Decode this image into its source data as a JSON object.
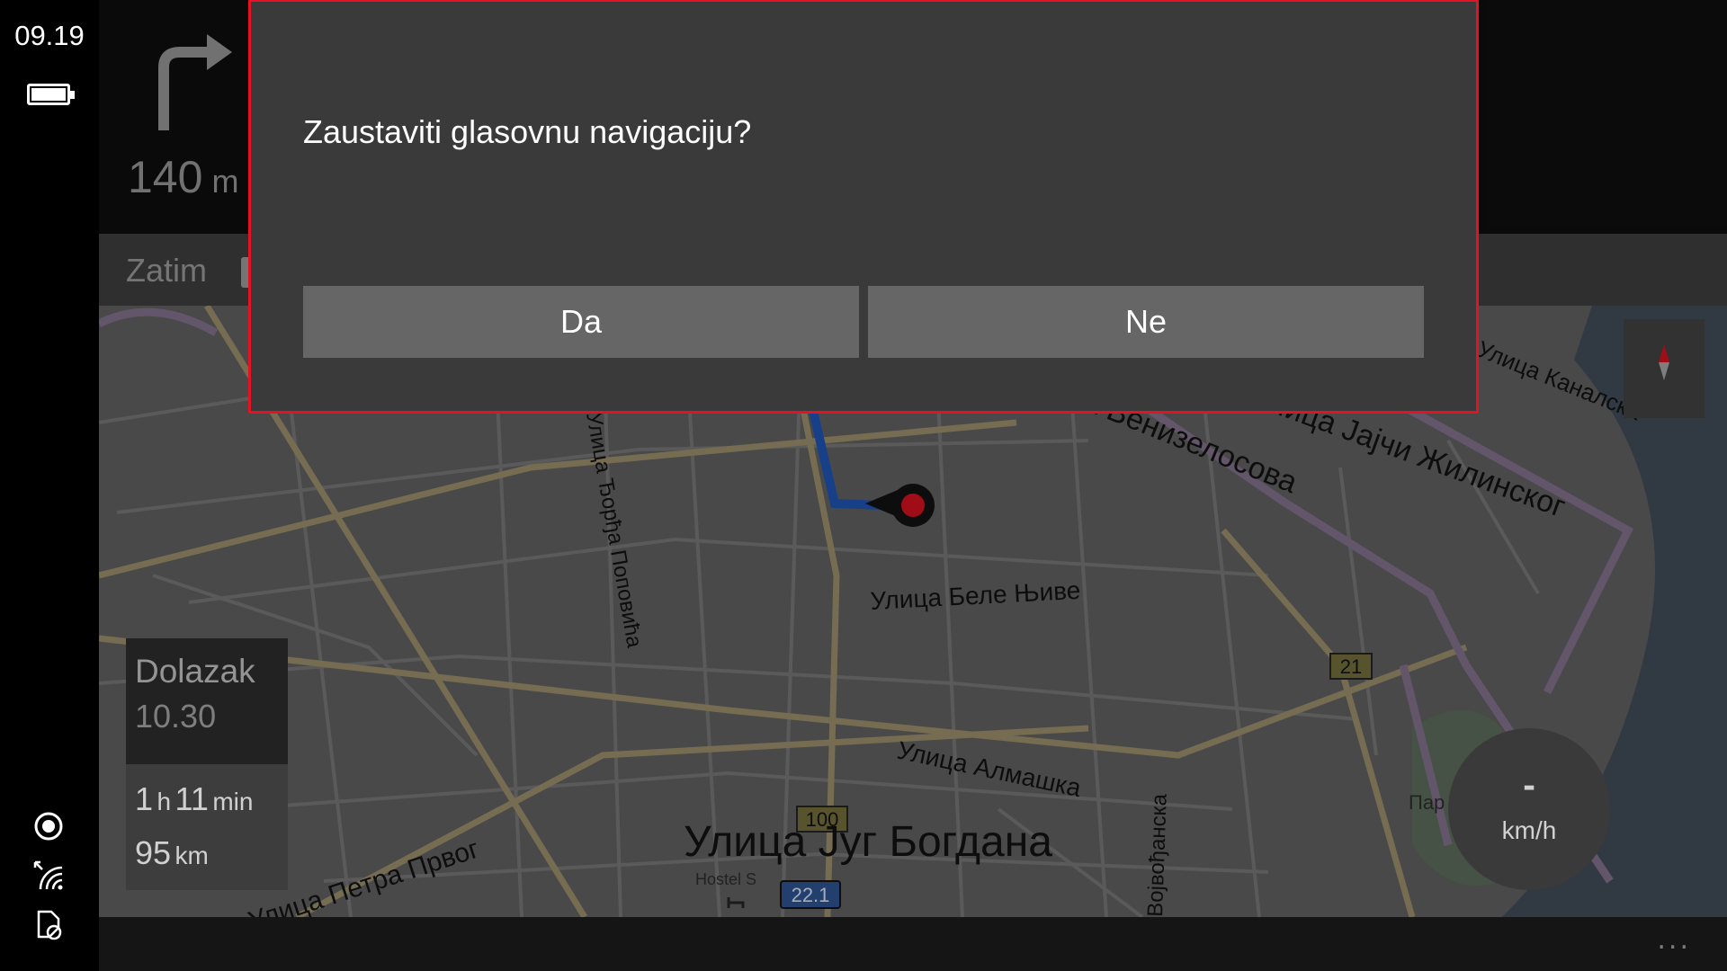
{
  "status": {
    "time": "09.19",
    "battery_icon": "battery-icon"
  },
  "instruction": {
    "distance": "140",
    "distance_unit": "m",
    "turn_icon": "turn-right-icon"
  },
  "then": {
    "label": "Zatim"
  },
  "map": {
    "streets": [
      "Улица Венизелосова",
      "Улица Беле Њиве",
      "Улица Алмашка",
      "Улица Југ Богдана",
      "Војвођанска",
      "Улица Петра Првог",
      "Улица Јајчи Жилинског",
      "Улица Каналска",
      "Улица Ђорђа Поповића"
    ],
    "poi": [
      "Hostel S",
      "Пар"
    ],
    "road_badges": [
      "21",
      "21",
      "100",
      "22.1"
    ],
    "route_color": "#1e4fa8",
    "accent_color": "#c4101c"
  },
  "arrival": {
    "label": "Dolazak",
    "time": "10.30"
  },
  "trip": {
    "hours": "1",
    "h_unit": "h",
    "minutes": "11",
    "min_unit": "min",
    "distance": "95",
    "distance_unit": "km"
  },
  "speed": {
    "value": "-",
    "unit": "km/h"
  },
  "dialog": {
    "message": "Zaustaviti glasovnu navigaciju?",
    "yes": "Da",
    "no": "Ne",
    "border_color": "#e81123"
  },
  "appbar": {
    "more": "..."
  }
}
